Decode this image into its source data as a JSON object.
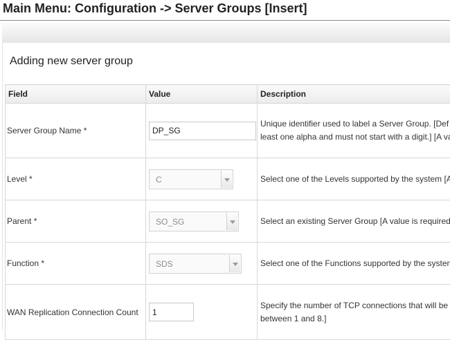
{
  "header": {
    "title": "Main Menu: Configuration -> Server Groups [Insert]"
  },
  "form": {
    "heading": "Adding new server group",
    "columns": {
      "field": "Field",
      "value": "Value",
      "description": "Description"
    },
    "rows": [
      {
        "label": "Server Group Name *",
        "value": "DP_SG",
        "desc_line1": "Unique identifier used to label a Server Group. [Def",
        "desc_line2": "least one alpha and must not start with a digit.] [A va"
      },
      {
        "label": "Level *",
        "value": "C",
        "desc_line1": "Select one of the Levels supported by the system [A"
      },
      {
        "label": "Parent *",
        "value": "SO_SG",
        "desc_line1": "Select an existing Server Group [A value is required"
      },
      {
        "label": "Function *",
        "value": "SDS",
        "desc_line1": "Select one of the Functions supported by the system"
      },
      {
        "label": "WAN Replication Connection Count",
        "value": "1",
        "desc_line1": "Specify the number of TCP connections that will be",
        "desc_line2": "between 1 and 8.]"
      }
    ]
  }
}
